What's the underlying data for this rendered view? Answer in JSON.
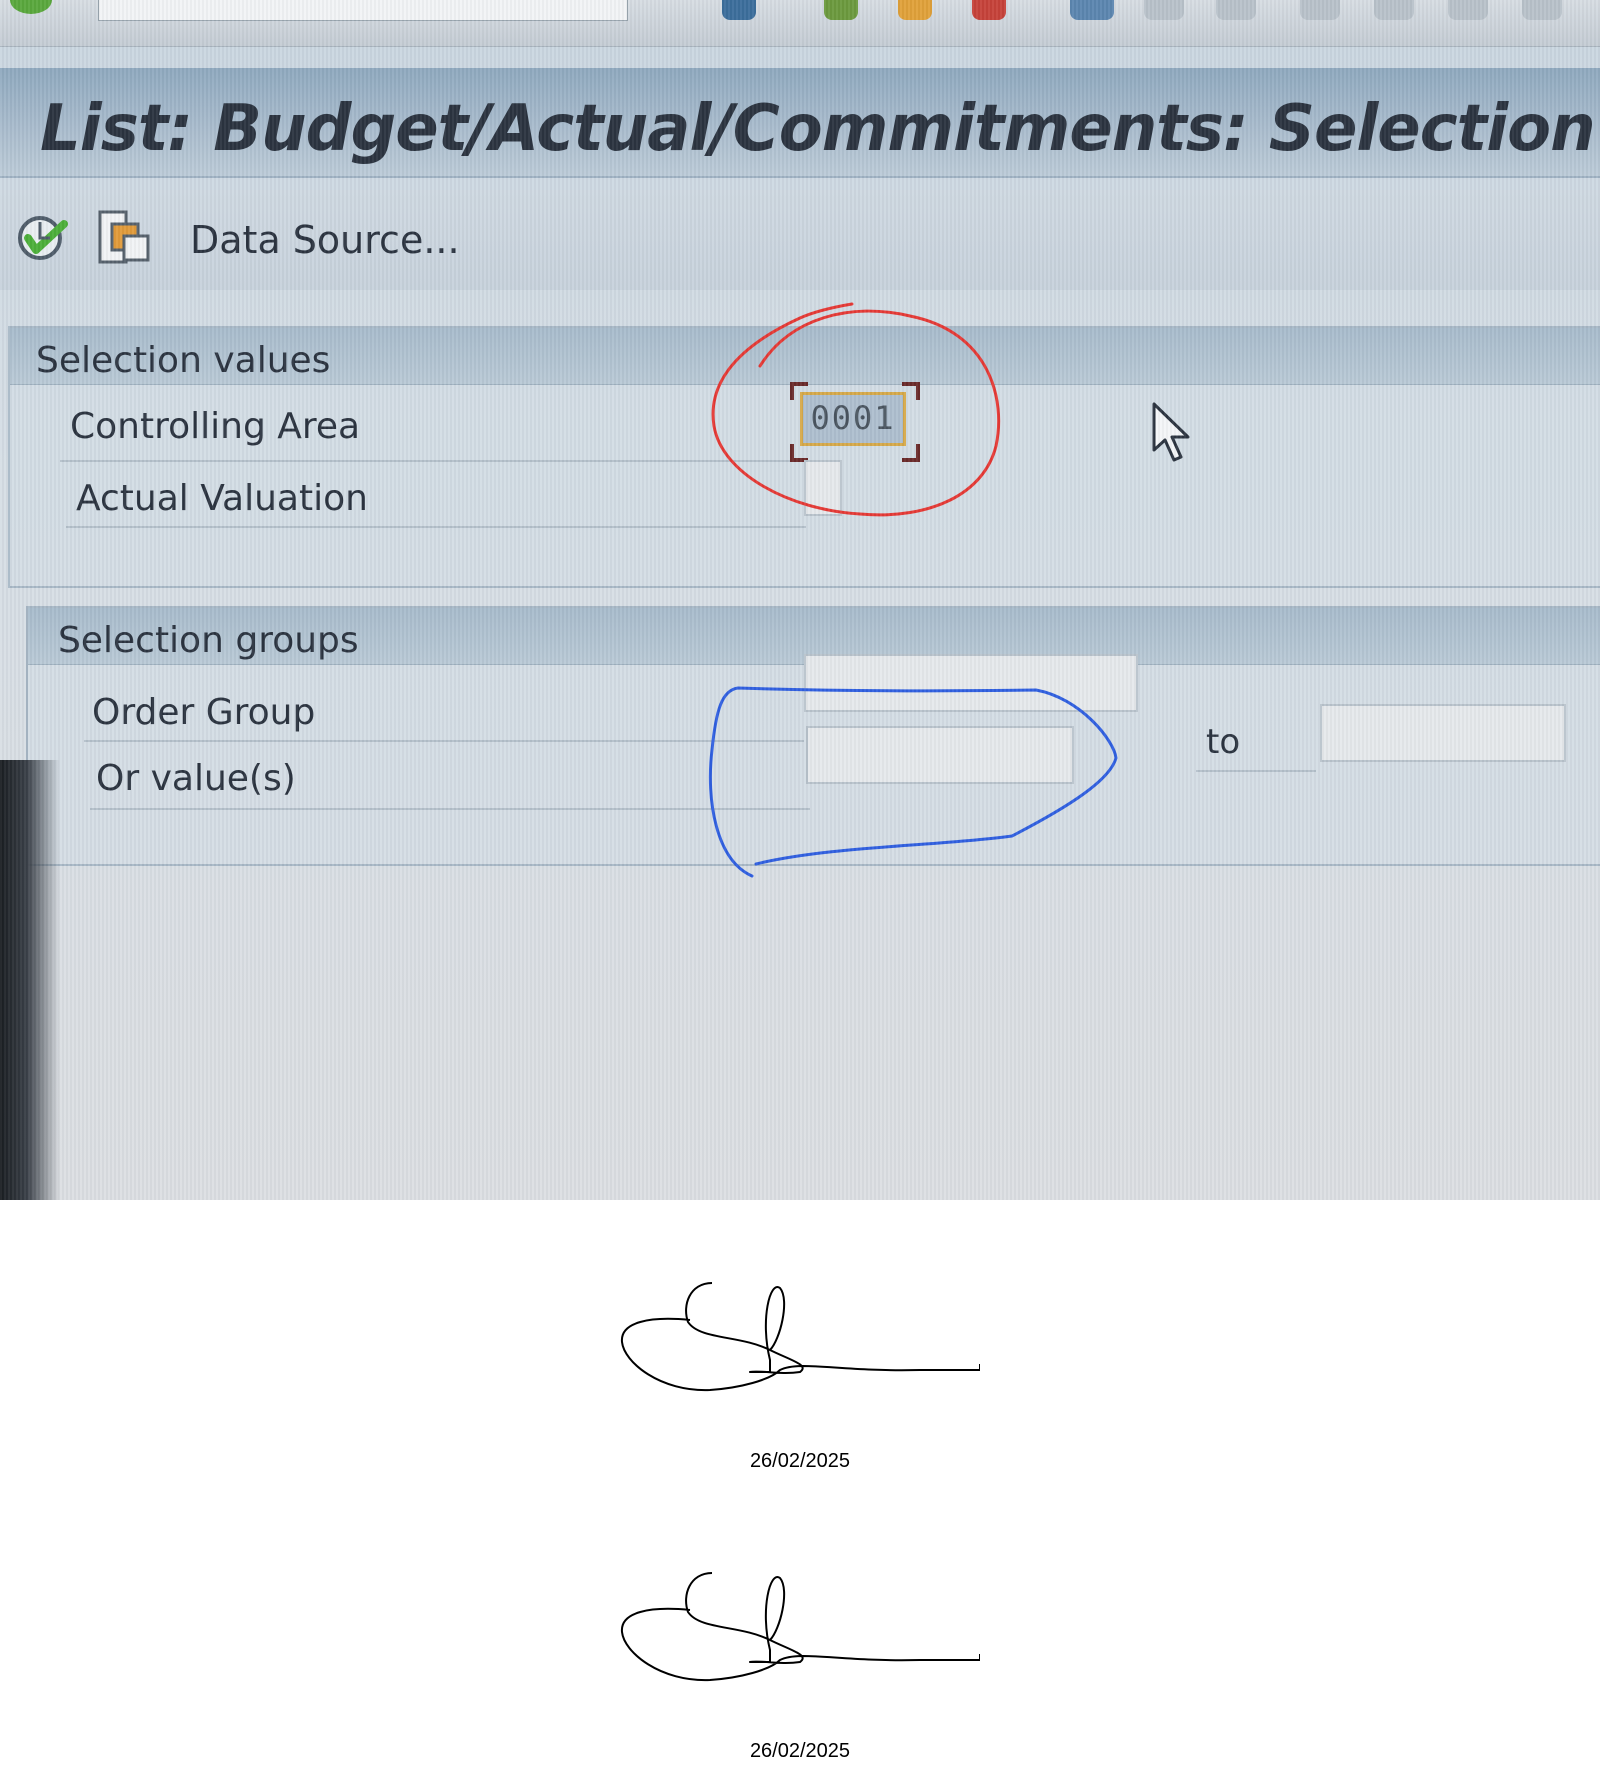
{
  "window": {
    "title": "List: Budget/Actual/Commitments: Selection"
  },
  "app_toolbar": {
    "execute_icon": "execute-icon",
    "variant_icon": "get-variant-icon",
    "data_source_label": "Data Source..."
  },
  "selection_values": {
    "title": "Selection values",
    "controlling_area_label": "Controlling Area",
    "controlling_area_value": "0001",
    "actual_valuation_label": "Actual Valuation"
  },
  "selection_groups": {
    "title": "Selection groups",
    "order_group_label": "Order Group",
    "or_values_label": "Or value(s)",
    "to_label": "to"
  },
  "annotations": {
    "red_circle_color": "#e53935",
    "blue_outline_color": "#2f5fe0"
  },
  "signatures": [
    {
      "date": "26/02/2025"
    },
    {
      "date": "26/02/2025"
    }
  ]
}
